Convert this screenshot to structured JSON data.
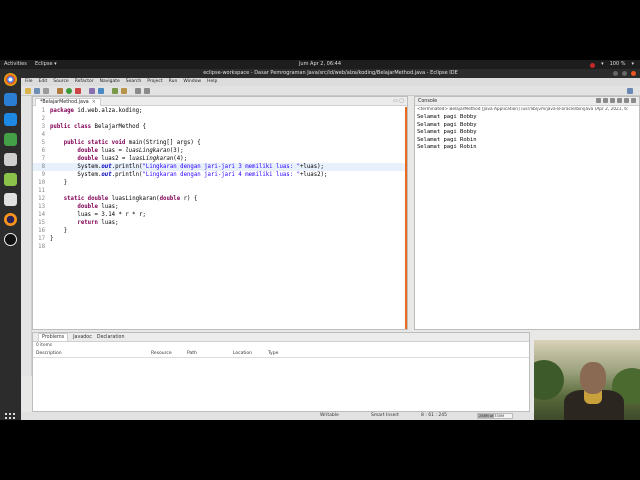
{
  "gnome": {
    "activities": "Activities",
    "app_menu": "Eclipse ▾",
    "clock": "Jum Apr 2, 06:44",
    "battery": "100 %"
  },
  "window": {
    "title": "eclipse-workspace - Dasar Pemrograman Java/src/id/web/alza/koding/BelajarMethod.java - Eclipse IDE"
  },
  "menu": [
    "File",
    "Edit",
    "Source",
    "Refactor",
    "Navigate",
    "Search",
    "Project",
    "Run",
    "Window",
    "Help"
  ],
  "editor": {
    "tab_label": "*BelajarMethod.java",
    "lines": [
      {
        "n": "1",
        "tokens": [
          {
            "t": "package",
            "c": "kw"
          },
          {
            "t": " id.web.alza.koding;",
            "c": ""
          }
        ]
      },
      {
        "n": "2",
        "tokens": []
      },
      {
        "n": "3",
        "tokens": [
          {
            "t": "public class",
            "c": "kw"
          },
          {
            "t": " BelajarMethod {",
            "c": ""
          }
        ]
      },
      {
        "n": "4",
        "tokens": []
      },
      {
        "n": "5",
        "tokens": [
          {
            "t": "    ",
            "c": ""
          },
          {
            "t": "public static void",
            "c": "kw"
          },
          {
            "t": " main(String[] args) {",
            "c": ""
          }
        ]
      },
      {
        "n": "6",
        "tokens": [
          {
            "t": "        ",
            "c": ""
          },
          {
            "t": "double",
            "c": "kw"
          },
          {
            "t": " luas = ",
            "c": ""
          },
          {
            "t": "luasLingkaran",
            "c": "it"
          },
          {
            "t": "(3);",
            "c": ""
          }
        ]
      },
      {
        "n": "7",
        "tokens": [
          {
            "t": "        ",
            "c": ""
          },
          {
            "t": "double",
            "c": "kw"
          },
          {
            "t": " luas2 = ",
            "c": ""
          },
          {
            "t": "luasLingkaran",
            "c": "it"
          },
          {
            "t": "(4);",
            "c": ""
          }
        ]
      },
      {
        "n": "8",
        "hl": true,
        "tokens": [
          {
            "t": "        System.",
            "c": ""
          },
          {
            "t": "out",
            "c": "fld"
          },
          {
            "t": ".println(",
            "c": ""
          },
          {
            "t": "\"Lingkaran dengan jari-jari 3 memiliki luas: \"",
            "c": "str"
          },
          {
            "t": "+luas);",
            "c": ""
          }
        ]
      },
      {
        "n": "9",
        "tokens": [
          {
            "t": "        System.",
            "c": ""
          },
          {
            "t": "out",
            "c": "fld"
          },
          {
            "t": ".println(",
            "c": ""
          },
          {
            "t": "\"Lingkaran dengan jari-jari 4 memiliki luas: \"",
            "c": "str"
          },
          {
            "t": "+luas2);",
            "c": ""
          }
        ]
      },
      {
        "n": "10",
        "tokens": [
          {
            "t": "    }",
            "c": ""
          }
        ]
      },
      {
        "n": "11",
        "tokens": []
      },
      {
        "n": "12",
        "tokens": [
          {
            "t": "    ",
            "c": ""
          },
          {
            "t": "static double",
            "c": "kw"
          },
          {
            "t": " luasLingkaran(",
            "c": ""
          },
          {
            "t": "double",
            "c": "kw"
          },
          {
            "t": " r) {",
            "c": ""
          }
        ]
      },
      {
        "n": "13",
        "tokens": [
          {
            "t": "        ",
            "c": ""
          },
          {
            "t": "double",
            "c": "kw"
          },
          {
            "t": " luas;",
            "c": ""
          }
        ]
      },
      {
        "n": "14",
        "tokens": [
          {
            "t": "        luas = 3.14 * r * r;",
            "c": ""
          }
        ]
      },
      {
        "n": "15",
        "tokens": [
          {
            "t": "        ",
            "c": ""
          },
          {
            "t": "return",
            "c": "kw"
          },
          {
            "t": " luas;",
            "c": ""
          }
        ]
      },
      {
        "n": "16",
        "tokens": [
          {
            "t": "    }",
            "c": ""
          }
        ]
      },
      {
        "n": "17",
        "tokens": [
          {
            "t": "}",
            "c": ""
          }
        ]
      },
      {
        "n": "18",
        "tokens": []
      }
    ]
  },
  "console": {
    "tab_label": "Console",
    "terminated": "<terminated> BelajarMethod [Java Application] /usr/lib/jvm/java-8-oracle/bin/java (Apr 2, 2021, 6:",
    "output": [
      "Selamat pagi Bobby",
      "Selamat pagi Bobby",
      "Selamat pagi Bobby",
      "Selamat pagi Robin",
      "Selamat pagi Robin"
    ]
  },
  "bottom_panel": {
    "tabs": [
      "Problems",
      "Javadoc",
      "Declaration"
    ],
    "count": "0 items",
    "columns": [
      "Description",
      "Resource",
      "Path",
      "Location",
      "Type"
    ]
  },
  "statusbar": {
    "mode": "Writable",
    "insert": "Smart Insert",
    "position": "8 : 61 : 245",
    "heap": "258M of 330M"
  },
  "colors": {
    "keyword": "#7f0055",
    "string": "#2a00ff",
    "field": "#0000c0",
    "dirty_bar": "#e86a1c"
  }
}
